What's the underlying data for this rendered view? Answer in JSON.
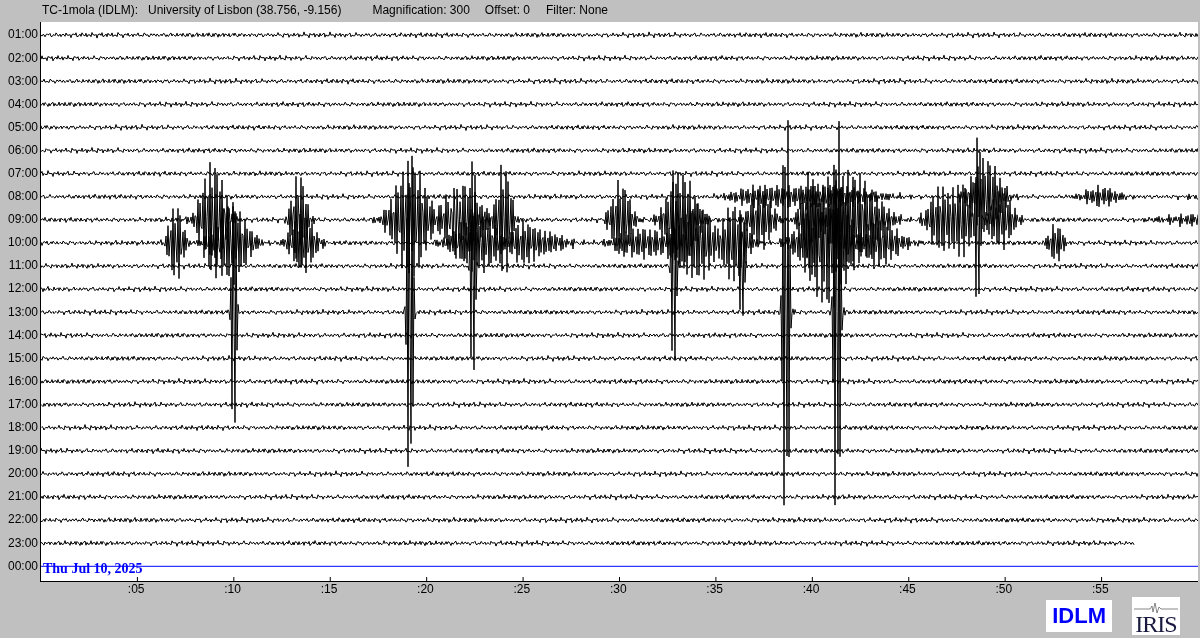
{
  "header": {
    "station": "TC-1mola (IDLM):",
    "location": "University of Lisbon (38.756, -9.156)",
    "magnification": "Magnification: 300",
    "offset": "Offset: 0",
    "filter": "Filter: None"
  },
  "plot": {
    "rows": [
      {
        "time": "01:00",
        "kind": "trace"
      },
      {
        "time": "02:00",
        "kind": "trace"
      },
      {
        "time": "03:00",
        "kind": "trace"
      },
      {
        "time": "04:00",
        "kind": "trace"
      },
      {
        "time": "05:00",
        "kind": "trace"
      },
      {
        "time": "06:00",
        "kind": "trace"
      },
      {
        "time": "07:00",
        "kind": "trace"
      },
      {
        "time": "08:00",
        "kind": "trace"
      },
      {
        "time": "09:00",
        "kind": "trace"
      },
      {
        "time": "10:00",
        "kind": "trace"
      },
      {
        "time": "11:00",
        "kind": "trace"
      },
      {
        "time": "12:00",
        "kind": "trace"
      },
      {
        "time": "13:00",
        "kind": "trace"
      },
      {
        "time": "14:00",
        "kind": "trace"
      },
      {
        "time": "15:00",
        "kind": "trace"
      },
      {
        "time": "16:00",
        "kind": "trace"
      },
      {
        "time": "17:00",
        "kind": "trace"
      },
      {
        "time": "18:00",
        "kind": "trace"
      },
      {
        "time": "19:00",
        "kind": "trace"
      },
      {
        "time": "20:00",
        "kind": "trace"
      },
      {
        "time": "21:00",
        "kind": "trace"
      },
      {
        "time": "22:00",
        "kind": "trace"
      },
      {
        "time": "23:00",
        "kind": "trace"
      },
      {
        "time": "00:00",
        "kind": "marker"
      }
    ],
    "date_label": "Thu Jul 10, 2025",
    "x_ticks": [
      ":05",
      ":10",
      ":15",
      ":20",
      ":25",
      ":30",
      ":35",
      ":40",
      ":45",
      ":50",
      ":55"
    ]
  },
  "logos": {
    "network": "IDLM",
    "iris": "IRIS"
  }
}
